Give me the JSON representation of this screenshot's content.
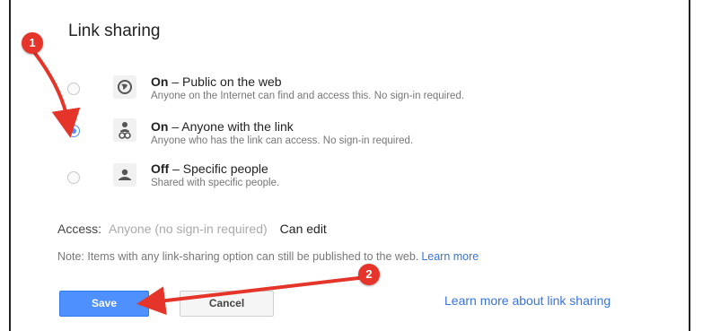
{
  "dialog": {
    "title": "Link sharing",
    "options": [
      {
        "state": "On",
        "dash": " – ",
        "title": "Public on the web",
        "description": "Anyone on the Internet can find and access this. No sign-in required.",
        "icon": "globe-icon",
        "selected": false
      },
      {
        "state": "On",
        "dash": " – ",
        "title": "Anyone with the link",
        "description": "Anyone who has the link can access. No sign-in required.",
        "icon": "people-link-icon",
        "selected": true
      },
      {
        "state": "Off",
        "dash": " – ",
        "title": "Specific people",
        "description": "Shared with specific people.",
        "icon": "person-lock-icon",
        "selected": false
      }
    ],
    "access": {
      "label": "Access:",
      "value": "Anyone (no sign-in required)",
      "permission": "Can edit"
    },
    "note": {
      "text": "Note: Items with any link-sharing option can still be published to the web.",
      "link": "Learn more"
    },
    "buttons": {
      "save": "Save",
      "cancel": "Cancel"
    },
    "learn_more_link": "Learn more about link sharing"
  },
  "annotations": {
    "badge_1": "1",
    "badge_2": "2",
    "color": "#e5352b"
  },
  "colors": {
    "accent": "#4d90fe",
    "link": "#3b73d9"
  }
}
